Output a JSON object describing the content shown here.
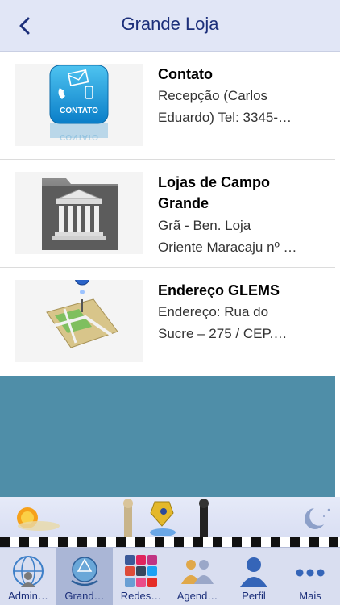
{
  "header": {
    "title": "Grande Loja",
    "back_icon": "chevron-left-icon"
  },
  "list": [
    {
      "title": "Contato",
      "subtitle_line1": "Recepção (Carlos",
      "subtitle_line2": "Eduardo) Tel: 3345-…",
      "thumb_icon": "contact-icon",
      "thumb_label": "CONTATO",
      "thumb_label_reflection": "CONTATO"
    },
    {
      "title_line1": "Lojas de Campo",
      "title_line2": "Grande",
      "subtitle_line1": "Grã - Ben. Loja",
      "subtitle_line2": "Oriente Maracaju nº …",
      "thumb_icon": "folder-building-icon"
    },
    {
      "title": "Endereço GLEMS",
      "subtitle_line1": "Endereço: Rua do",
      "subtitle_line2": "Sucre – 275 / CEP.…",
      "thumb_icon": "map-pin-icon"
    }
  ],
  "tabs": [
    {
      "label": "Admin…",
      "icon": "admin-globe-icon",
      "active": false
    },
    {
      "label": "Grand…",
      "icon": "emblem-icon",
      "active": true
    },
    {
      "label": "Redes…",
      "icon": "social-networks-icon",
      "active": false
    },
    {
      "label": "Agend…",
      "icon": "agenda-people-icon",
      "active": false
    },
    {
      "label": "Perfil",
      "icon": "profile-icon",
      "active": false
    },
    {
      "label": "Mais",
      "icon": "more-icon",
      "active": false
    }
  ],
  "colors": {
    "accent": "#1c2f7a",
    "fill": "#4f8ea8",
    "navbar": "#e1e6f6",
    "tabbar": "#d9def0"
  }
}
